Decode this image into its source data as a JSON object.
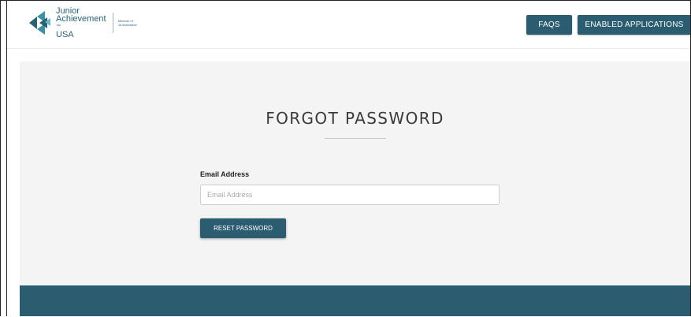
{
  "header": {
    "logo": {
      "line1": "Junior",
      "line2": "Achievement",
      "tm": "™",
      "line3": "USA",
      "member_line1": "Member of",
      "member_line2": "JA Worldwide"
    },
    "faqs_label": "FAQS",
    "enabled_apps_label": "ENABLED APPLICATIONS"
  },
  "main": {
    "title": "FORGOT PASSWORD",
    "email_label": "Email Address",
    "email_placeholder": "Email Address",
    "email_value": "",
    "reset_label": "RESET PASSWORD"
  },
  "colors": {
    "brand": "#2b5c6f",
    "panel": "#f4f4f4"
  }
}
